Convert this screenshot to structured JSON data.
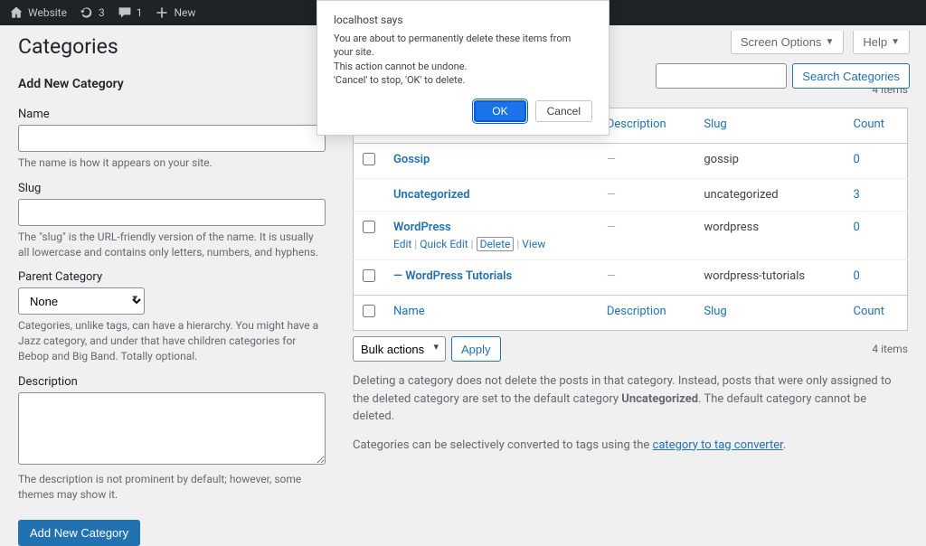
{
  "adminbar": {
    "site_name": "Website",
    "updates_count": "3",
    "comments_count": "1",
    "new_label": "New"
  },
  "modal": {
    "title": "localhost says",
    "line1": "You are about to permanently delete these items from your site.",
    "line2": "This action cannot be undone.",
    "line3": "'Cancel' to stop, 'OK' to delete.",
    "ok": "OK",
    "cancel": "Cancel"
  },
  "screen": {
    "options": "Screen Options",
    "help": "Help"
  },
  "page": {
    "title": "Categories",
    "search_button": "Search Categories"
  },
  "form": {
    "heading": "Add New Category",
    "name_label": "Name",
    "name_help": "The name is how it appears on your site.",
    "slug_label": "Slug",
    "slug_help": "The \"slug\" is the URL-friendly version of the name. It is usually all lowercase and contains only letters, numbers, and hyphens.",
    "parent_label": "Parent Category",
    "parent_selected": "None",
    "parent_help": "Categories, unlike tags, can have a hierarchy. You might have a Jazz category, and under that have children categories for Bebop and Big Band. Totally optional.",
    "desc_label": "Description",
    "desc_help": "The description is not prominent by default; however, some themes may show it.",
    "submit": "Add New Category"
  },
  "table": {
    "bulk_label": "Bulk actions",
    "apply": "Apply",
    "items_text": "4 items",
    "col_name": "Name",
    "col_desc": "Description",
    "col_slug": "Slug",
    "col_count": "Count",
    "rows": [
      {
        "name": "Gossip",
        "desc": "—",
        "slug": "gossip",
        "count": "0",
        "show_cb": true,
        "indent": ""
      },
      {
        "name": "Uncategorized",
        "desc": "—",
        "slug": "uncategorized",
        "count": "3",
        "show_cb": false,
        "indent": ""
      },
      {
        "name": "WordPress",
        "desc": "—",
        "slug": "wordpress",
        "count": "0",
        "show_cb": true,
        "indent": ""
      },
      {
        "name": "— WordPress Tutorials",
        "desc": "—",
        "slug": "wordpress-tutorials",
        "count": "0",
        "show_cb": true,
        "indent": ""
      }
    ],
    "row_actions": {
      "edit": "Edit",
      "quick": "Quick Edit",
      "delete": "Delete",
      "view": "View"
    }
  },
  "footer": {
    "text1a": "Deleting a category does not delete the posts in that category. Instead, posts that were only assigned to the deleted category are set to the default category ",
    "bold": "Uncategorized",
    "text1b": ". The default category cannot be deleted.",
    "text2a": "Categories can be selectively converted to tags using the ",
    "link": "category to tag converter",
    "text2b": "."
  }
}
